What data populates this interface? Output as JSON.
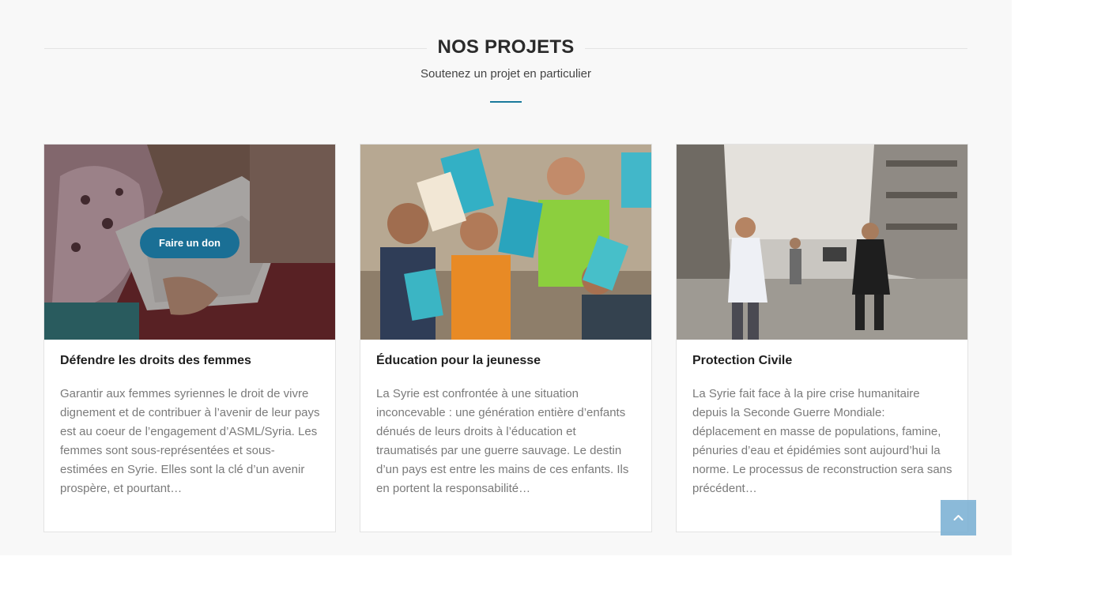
{
  "section": {
    "title": "NOS PROJETS",
    "subtitle": "Soutenez un projet en particulier"
  },
  "projects": [
    {
      "title": "Défendre les droits des femmes",
      "excerpt": "Garantir aux femmes syriennes le droit de vivre dignement et de contribuer à l’avenir de leur pays est au coeur de l’engagement d’ASML/Syria. Les femmes sont sous-représentées et sous-estimées en Syrie. Elles sont la clé d’un avenir prospère, et pourtant…",
      "donate_label": "Faire un don"
    },
    {
      "title": "Éducation pour la jeunesse",
      "excerpt": "La Syrie est confrontée à une situation inconcevable : une génération entière d’enfants dénués de leurs droits à l’éducation et traumatisés par une guerre sauvage. Le destin d’un pays est entre les mains de ces enfants. Ils en portent la responsabilité…"
    },
    {
      "title": "Protection Civile",
      "excerpt": "La Syrie fait face à la pire crise humanitaire depuis la Seconde Guerre Mondiale: déplacement en masse de populations, famine, pénuries d’eau et épidémies sont aujourd’hui la norme. Le processus de reconstruction sera sans précédent…"
    }
  ],
  "icons": {
    "back_to_top": "chevron-up-icon"
  },
  "colors": {
    "accent": "#1a7a9c",
    "button": "#1a6f95",
    "back_to_top": "#7fb3d5",
    "section_bg": "#f8f8f8"
  }
}
